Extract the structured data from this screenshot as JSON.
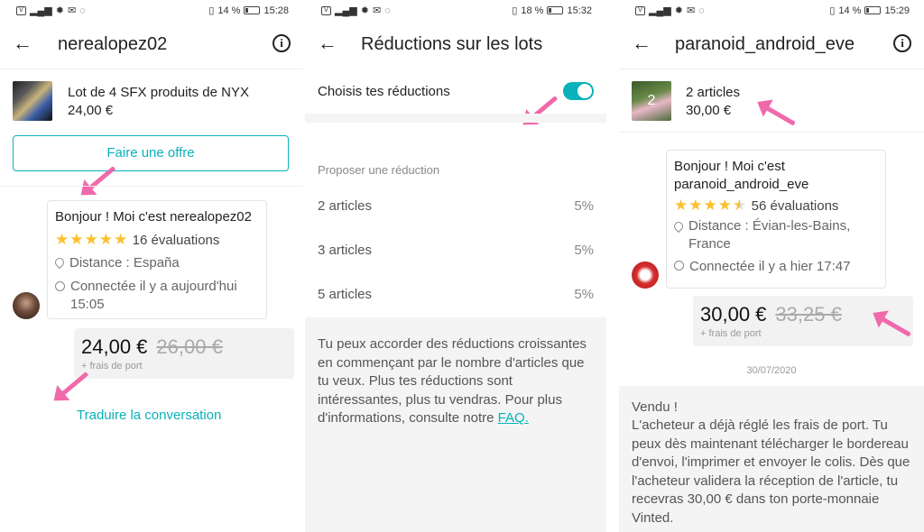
{
  "status_bars": [
    {
      "battery": "14 %",
      "time": "15:28"
    },
    {
      "battery": "18 %",
      "time": "15:32"
    },
    {
      "battery": "14 %",
      "time": "15:29"
    }
  ],
  "panel1": {
    "title": "nerealopez02",
    "item": {
      "name": "Lot de 4 SFX produits de NYX",
      "price": "24,00 €"
    },
    "offer_button": "Faire une offre",
    "bubble": {
      "hello": "Bonjour ! Moi c'est nerealopez02",
      "stars": "★★★★★",
      "reviews": "16 évaluations",
      "distance": "Distance : España",
      "connected": "Connectée il y a aujourd'hui 15:05"
    },
    "price": {
      "current": "24,00 €",
      "old": "26,00 €",
      "shipping": "+ frais de port"
    },
    "translate_link": "Traduire la conversation"
  },
  "panel2": {
    "title": "Réductions sur les lots",
    "toggle_label": "Choisis tes réductions",
    "toggle_on": true,
    "section_label": "Proposer une réduction",
    "rows": [
      {
        "label": "2 articles",
        "pct": "5%"
      },
      {
        "label": "3 articles",
        "pct": "5%"
      },
      {
        "label": "5 articles",
        "pct": "5%"
      }
    ],
    "info_text": "Tu peux accorder des réductions croissantes en commençant par le nombre d'articles que tu veux. Plus tes réductions sont intéressantes, plus tu vendras. Pour plus d'informations, consulte notre",
    "faq_link": "FAQ."
  },
  "panel3": {
    "title": "paranoid_android_eve",
    "item": {
      "name": "2 articles",
      "price": "30,00 €",
      "thumb_count": "2"
    },
    "bubble": {
      "hello": "Bonjour ! Moi c'est paranoid_android_eve",
      "stars": "★★★★",
      "half_star": "★",
      "reviews": "56 évaluations",
      "distance": "Distance : Évian-les-Bains, France",
      "connected": "Connectée il y a hier 17:47"
    },
    "price": {
      "current": "30,00 €",
      "old": "33,25 €",
      "shipping": "+ frais de port"
    },
    "date": "30/07/2020",
    "sold_title": "Vendu !",
    "sold_text": "L'acheteur a déjà réglé les frais de port. Tu peux dès maintenant télécharger le bordereau d'envoi, l'imprimer et envoyer le colis. Dès que l'acheteur validera la réception de l'article, tu recevras 30,00 € dans ton porte-monnaie Vinted."
  },
  "colors": {
    "accent": "#09b1ba",
    "arrow": "#f06aab",
    "stars": "#fbc02d"
  }
}
